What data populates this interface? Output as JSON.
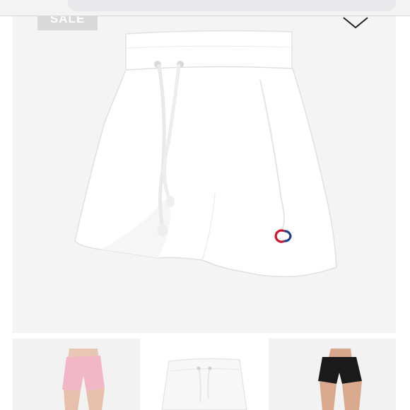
{
  "listing": {
    "badge_label": "SALE",
    "expand_icon": "chevron-down-icon",
    "main_image": "white-shorts-image",
    "logo_mark": "C"
  },
  "thumbnails": [
    {
      "name": "pink-shorts-thumbnail"
    },
    {
      "name": "white-shorts-thumbnail"
    },
    {
      "name": "black-shorts-thumbnail"
    }
  ],
  "colors": {
    "background": "#f4f4f4",
    "badge": "#d9d9d9",
    "logo_red": "#d0142b",
    "logo_blue": "#1d3f8c",
    "pink_shorts": "#f2b7c6",
    "black_shorts": "#1a1a1a"
  }
}
